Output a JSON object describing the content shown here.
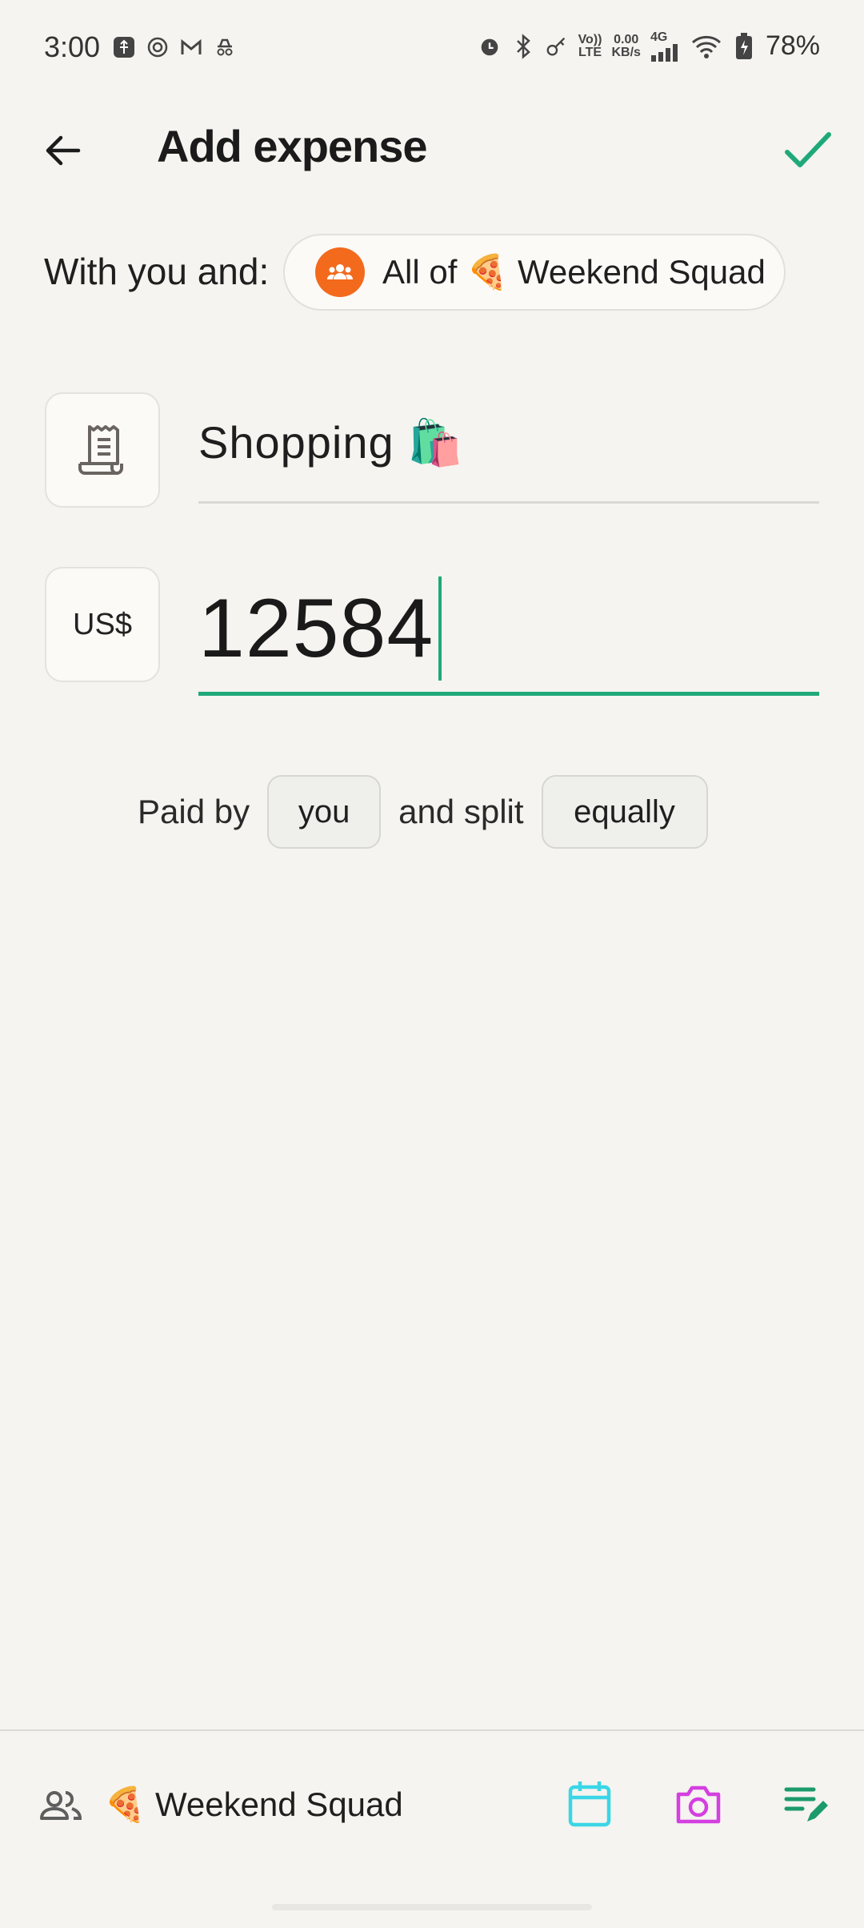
{
  "status_bar": {
    "time": "3:00",
    "left_icons": [
      "usb-icon",
      "openai-icon",
      "gmail-icon",
      "incognito-icon"
    ],
    "right_icons": [
      "alarm-icon",
      "bluetooth-icon",
      "key-icon",
      "volte-icon",
      "data-speed-icon",
      "signal-icon",
      "wifi-icon",
      "battery-icon"
    ],
    "volte_line1": "Vo))",
    "volte_line2": "LTE",
    "speed_line1": "0.00",
    "speed_line2": "KB/s",
    "network": "4G",
    "battery": "78%"
  },
  "header": {
    "title": "Add expense"
  },
  "with_section": {
    "label": "With you and:",
    "chip_text": "All of 🍕 Weekend Squad"
  },
  "description": {
    "value": "Shopping 🛍️"
  },
  "amount": {
    "currency": "US$",
    "value": "12584"
  },
  "split": {
    "paid_by_label": "Paid by",
    "payer": "you",
    "split_label": "and split",
    "method": "equally"
  },
  "bottom_bar": {
    "group_name": "🍕 Weekend Squad"
  },
  "colors": {
    "accent": "#1fa97a",
    "group_avatar": "#f36a1d",
    "calendar": "#3ad6e6",
    "camera": "#d43fe0",
    "notes": "#1b9a6c"
  }
}
